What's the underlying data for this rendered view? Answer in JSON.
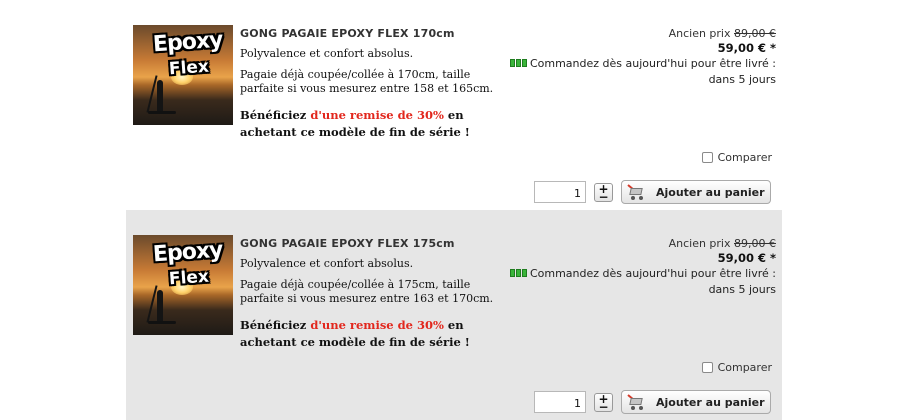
{
  "products": [
    {
      "image_text_1": "Epoxy",
      "image_text_2": "Flex",
      "title": "GONG PAGAIE EPOXY FLEX 170cm",
      "tagline": "Polyvalence et confort absolus.",
      "description": "Pagaie déjà coupée/collée à 170cm, taille parfaite si vous mesurez entre 158 et 165cm.",
      "promo_prefix": "Bénéficiez ",
      "promo_highlight": "d'une remise de 30%",
      "promo_suffix": " en achetant ce modèle de fin de série !",
      "old_price_label": "Ancien prix ",
      "old_price": "89,00 €",
      "new_price": "59,00 € *",
      "delivery": "Commandez dès aujourd'hui pour être livré : dans 5 jours",
      "compare_label": "Comparer",
      "quantity": "1",
      "stepper_plus": "+",
      "stepper_minus": "−",
      "add_to_cart": "Ajouter au panier"
    },
    {
      "image_text_1": "Epoxy",
      "image_text_2": "Flex",
      "title": "GONG PAGAIE EPOXY FLEX 175cm",
      "tagline": "Polyvalence et confort absolus.",
      "description": "Pagaie déjà coupée/collée à 175cm, taille parfaite si vous mesurez entre 163 et 170cm.",
      "promo_prefix": "Bénéficiez ",
      "promo_highlight": "d'une remise de 30%",
      "promo_suffix": " en achetant ce modèle de fin de série !",
      "old_price_label": "Ancien prix ",
      "old_price": "89,00 €",
      "new_price": "59,00 € *",
      "delivery": "Commandez dès aujourd'hui pour être livré : dans 5 jours",
      "compare_label": "Comparer",
      "quantity": "1",
      "stepper_plus": "+",
      "stepper_minus": "−",
      "add_to_cart": "Ajouter au panier"
    }
  ],
  "icons": {
    "stock": "stock-indicator-icon",
    "cart": "cart-icon",
    "checkbox": "checkbox-icon"
  },
  "colors": {
    "promo_red": "#e2271d",
    "stock_green": "#3ab53a",
    "alt_row_bg": "#e6e6e6"
  }
}
